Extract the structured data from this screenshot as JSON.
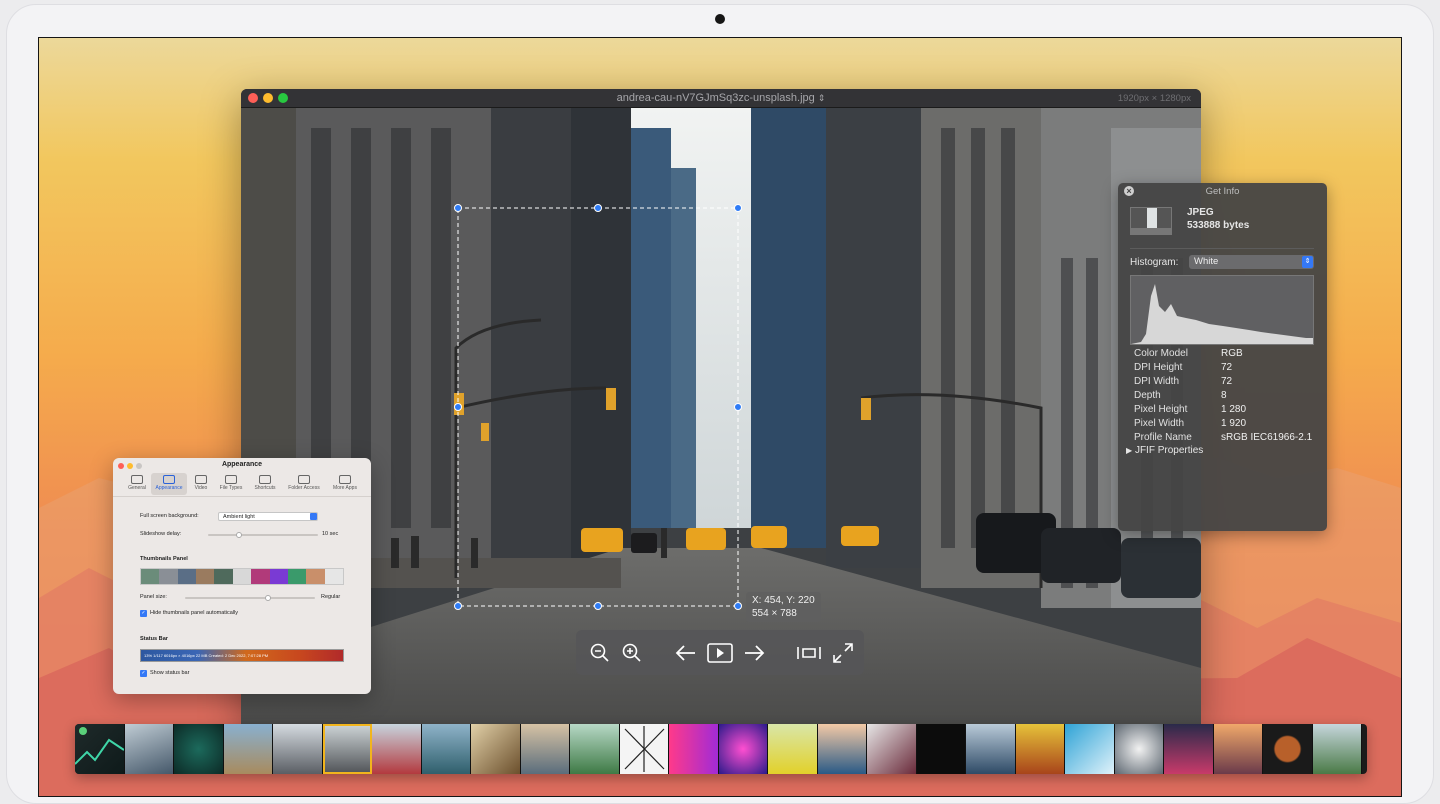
{
  "window": {
    "filename": "andrea-cau-nV7GJmSq3zc-unsplash.jpg",
    "stepper_icon": "chevron-updown-icon",
    "dimensions": "1920px × 1280px"
  },
  "selection": {
    "coords": "X: 454, Y: 220",
    "size": "554 × 788"
  },
  "toolbar": {
    "icons": [
      "zoom-out-icon",
      "zoom-in-icon",
      "arrow-left-icon",
      "play-icon",
      "arrow-right-icon",
      "fit-width-icon",
      "fullscreen-icon"
    ]
  },
  "get_info": {
    "title": "Get Info",
    "file_type": "JPEG",
    "file_size": "533888 bytes",
    "histogram_label": "Histogram:",
    "histogram_value": "White",
    "properties": [
      {
        "key": "Color Model",
        "value": "RGB"
      },
      {
        "key": "DPI Height",
        "value": "72"
      },
      {
        "key": "DPI Width",
        "value": "72"
      },
      {
        "key": "Depth",
        "value": "8"
      },
      {
        "key": "Pixel Height",
        "value": "1 280"
      },
      {
        "key": "Pixel Width",
        "value": "1 920"
      },
      {
        "key": "Profile Name",
        "value": "sRGB IEC61966-2.1"
      }
    ],
    "jfif_label": "JFIF Properties"
  },
  "preferences": {
    "title": "Appearance",
    "tabs": [
      "General",
      "Appearance",
      "Video",
      "File Types",
      "Shortcuts",
      "Folder Access",
      "More Apps"
    ],
    "selected_tab": "Appearance",
    "fullscreen_label": "Full screen background:",
    "fullscreen_value": "Ambient light",
    "slideshow_label": "Slideshow delay:",
    "slideshow_value": "10 sec",
    "thumbnails_heading": "Thumbnails Panel",
    "panel_size_label": "Panel size:",
    "panel_size_value": "Regular",
    "hide_thumbnails_label": "Hide thumbnails panel automatically",
    "status_heading": "Status Bar",
    "status_preview": "13%   1/117   6016px × 4016px   22 MB   Created: 2 Dec 2022, 7:07:28 PM",
    "show_status_label": "Show status bar"
  },
  "colors": {
    "accent": "#3478f6",
    "selected_thumb": "#f2b51d",
    "close_red": "#fe5f57",
    "minimize_yellow": "#febc2e",
    "zoom_green": "#28c840"
  }
}
